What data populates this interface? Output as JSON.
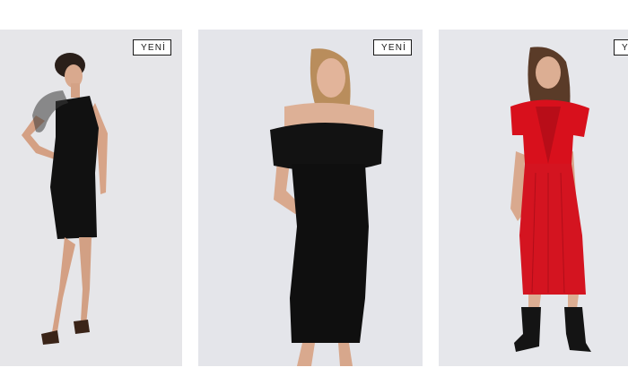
{
  "products": [
    {
      "badge": "YENİ",
      "photo": "model-black-one-shoulder-dress-photo"
    },
    {
      "badge": "YENİ",
      "photo": "model-black-off-shoulder-ruffle-dress-photo"
    },
    {
      "badge": "YENİ",
      "photo": "model-red-ruffle-midi-dress-photo"
    }
  ],
  "colors": {
    "background": "#ffffff",
    "photo_backdrop": "#e6e6e9",
    "badge_border": "#1a1a1a",
    "dress_black": "#111111",
    "dress_red": "#d8101c"
  }
}
